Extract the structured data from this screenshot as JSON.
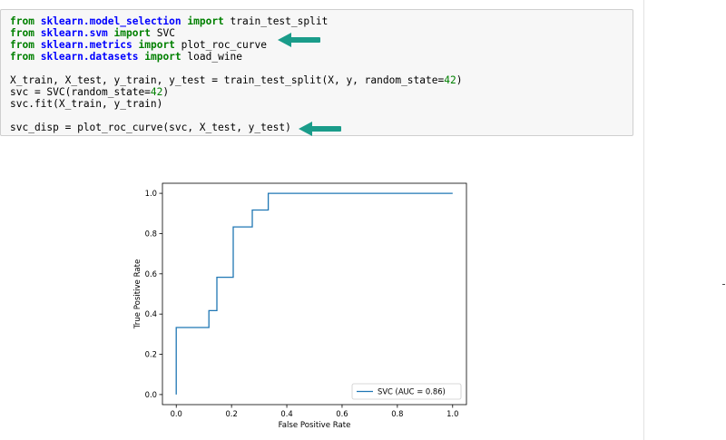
{
  "code": {
    "lines": [
      {
        "kw1": "from",
        "mod": "sklearn.model_selection",
        "kw2": "import",
        "name": "train_test_split"
      },
      {
        "kw1": "from",
        "mod": "sklearn.svm",
        "kw2": "import",
        "name": "SVC"
      },
      {
        "kw1": "from",
        "mod": "sklearn.metrics",
        "kw2": "import",
        "name": "plot_roc_curve"
      },
      {
        "kw1": "from",
        "mod": "sklearn.datasets",
        "kw2": "import",
        "name": "load_wine"
      },
      {
        "pre": "X_train, X_test, y_train, y_test = train_test_split(X, y, random_state=",
        "num": "42",
        "post": ")"
      },
      {
        "pre": "svc = SVC(random_state=",
        "num": "42",
        "post": ")"
      },
      {
        "pre": "svc.fit(X_train, y_train)",
        "num": "",
        "post": ""
      },
      {
        "pre": "svc_disp = plot_roc_curve(svc, X_test, y_test)",
        "num": "",
        "post": ""
      }
    ]
  },
  "colors": {
    "arrow": "#1a9c8a",
    "curve": "#1f77b4"
  },
  "chart_data": {
    "type": "line",
    "title": "",
    "xlabel": "False Positive Rate",
    "ylabel": "True Positive Rate",
    "xlim": [
      -0.05,
      1.05
    ],
    "ylim": [
      -0.05,
      1.05
    ],
    "xticks": [
      "0.0",
      "0.2",
      "0.4",
      "0.6",
      "0.8",
      "1.0"
    ],
    "yticks": [
      "0.0",
      "0.2",
      "0.4",
      "0.6",
      "0.8",
      "1.0"
    ],
    "grid": false,
    "legend_position": "lower-right",
    "series": [
      {
        "name": "SVC (AUC = 0.86)",
        "x": [
          0.0,
          0.0,
          0.118,
          0.118,
          0.147,
          0.147,
          0.206,
          0.206,
          0.275,
          0.275,
          0.333,
          0.333,
          1.0
        ],
        "y": [
          0.0,
          0.333,
          0.333,
          0.417,
          0.417,
          0.583,
          0.583,
          0.833,
          0.833,
          0.917,
          0.917,
          1.0,
          1.0
        ]
      }
    ]
  }
}
